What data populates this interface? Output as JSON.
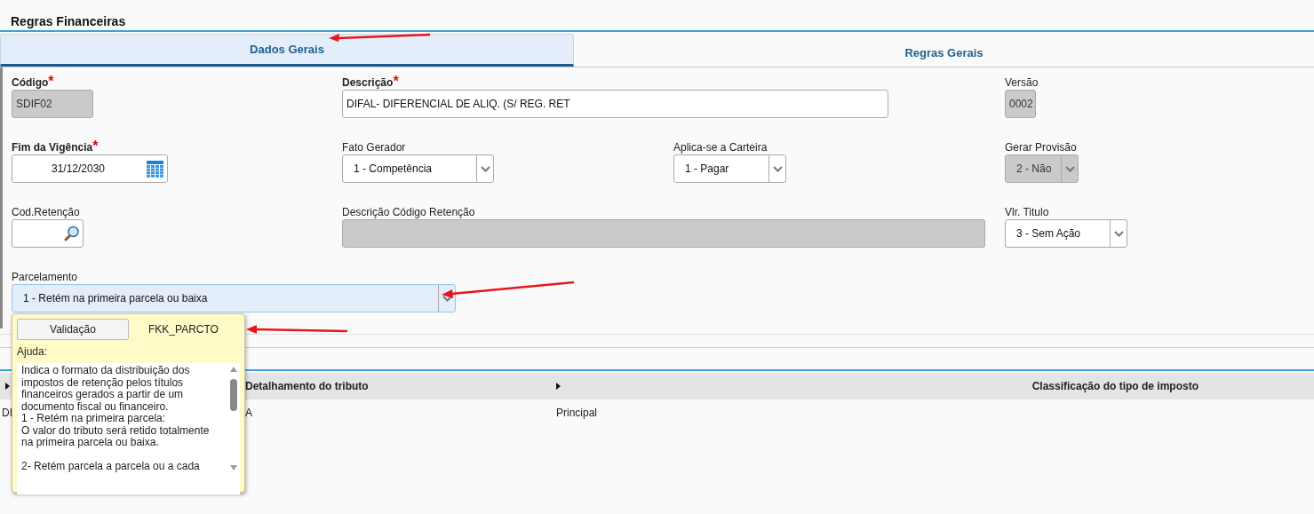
{
  "title": "Regras Financeiras",
  "tabs": [
    {
      "label": "Dados Gerais",
      "selected": true
    },
    {
      "label": "Regras Gerais",
      "selected": false
    }
  ],
  "form_rows": [
    [
      {
        "kind": "text",
        "label": "Código",
        "required_mark": "*",
        "value": "SDIF02",
        "disabled": true
      },
      {
        "kind": "text",
        "label": "Descrição",
        "required_mark": "*",
        "value": "DIFAL- DIFERENCIAL DE ALIQ. (S/ REG. RET",
        "disabled": false
      },
      {
        "kind": "text",
        "label": "Versão",
        "value": "0002",
        "disabled": true
      }
    ],
    [
      {
        "kind": "date",
        "label": "Fim da Vigência",
        "required_mark": "*",
        "value": "31/12/2030",
        "disabled": false
      },
      {
        "kind": "select",
        "label": "Fato Gerador",
        "value": "1 - Competência",
        "disabled": false
      },
      {
        "kind": "select",
        "label": "Aplica-se a Carteira",
        "value": "1 - Pagar",
        "disabled": false
      },
      {
        "kind": "select",
        "label": "Gerar Provisão",
        "value": "2 - Não",
        "disabled": true
      }
    ],
    [
      {
        "kind": "lookup",
        "label": "Cod.Retenção",
        "disabled": false
      },
      {
        "kind": "text",
        "label": "Descrição Código Retenção",
        "disabled": true
      },
      {
        "kind": "select",
        "label": "Vlr. Titulo",
        "value": "3 - Sem Ação",
        "disabled": false
      }
    ],
    [
      {
        "kind": "select",
        "label": "Parcelamento",
        "value": "1 -  Retém na primeira parcela ou baixa",
        "disabled": false,
        "focused": true
      }
    ]
  ],
  "table": {
    "columns": [
      {
        "sortable": true
      },
      {
        "label": "Detalhamento do tributo",
        "sortable": false
      },
      {
        "label": "Classificação do tipo de imposto",
        "sortable": true
      }
    ],
    "rows": [
      [
        "DI",
        "A",
        "Principal"
      ]
    ]
  },
  "help_popup": {
    "button": "Validação",
    "field_name": "FKK_PARCTO",
    "help_label": "Ajuda:",
    "help_text": [
      "Indica o formato da distribuição dos impostos de retenção pelos títulos financeiros gerados a partir de um documento fiscal ou financeiro.",
      "1 - Retém na primeira parcela:",
      "O valor do tributo será retido totalmente na primeira parcela ou baixa.",
      "2- Retém parcela a parcela ou a cada"
    ]
  }
}
